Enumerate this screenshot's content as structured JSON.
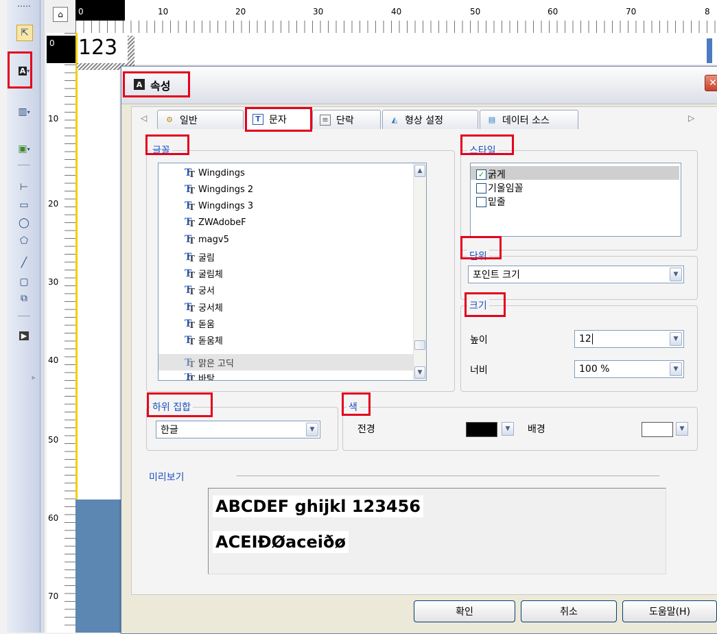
{
  "ruler": {
    "top": [
      "0",
      "10",
      "20",
      "30",
      "40",
      "50",
      "60",
      "70",
      "8"
    ],
    "left": [
      "0",
      "10",
      "20",
      "30",
      "40",
      "50",
      "60",
      "70"
    ]
  },
  "canvas": {
    "text": "123"
  },
  "dialog": {
    "title": "속성",
    "close_icon": "close-icon",
    "tabs": [
      "일반",
      "문자",
      "단락",
      "형상 설정",
      "데이터 소스"
    ],
    "font_group": {
      "title": "글꼴",
      "fonts": [
        "Wingdings",
        "Wingdings 2",
        "Wingdings 3",
        "ZWAdobeF",
        "magv5",
        "굴림",
        "굴림체",
        "궁서",
        "궁서체",
        "돋움",
        "돋움체",
        "맑은 고딕",
        "바탕"
      ],
      "selected": "맑은 고딕"
    },
    "style_group": {
      "title": "스타일",
      "items": [
        {
          "label": "굵게",
          "checked": true
        },
        {
          "label": "기울임꼴",
          "checked": false
        },
        {
          "label": "밑줄",
          "checked": false
        }
      ]
    },
    "unit_group": {
      "title": "단위",
      "value": "포인트 크기"
    },
    "size_group": {
      "title": "크기",
      "height_label": "높이",
      "height_value": "12",
      "width_label": "너비",
      "width_value": "100 %"
    },
    "subset_group": {
      "title": "하위 집합",
      "value": "한글"
    },
    "color_group": {
      "title": "색",
      "foreground_label": "전경",
      "foreground_color": "#000000",
      "background_label": "배경",
      "background_color": "#ffffff"
    },
    "preview": {
      "title": "미리보기",
      "line1": "ABCDEF ghijkl 123456",
      "line2": "ACEIĐØaceiðø"
    },
    "buttons": {
      "ok": "확인",
      "cancel": "취소",
      "help": "도움말(H)"
    }
  },
  "colors": {
    "highlight": "#e3001b",
    "group_title": "#1a4fbf"
  }
}
